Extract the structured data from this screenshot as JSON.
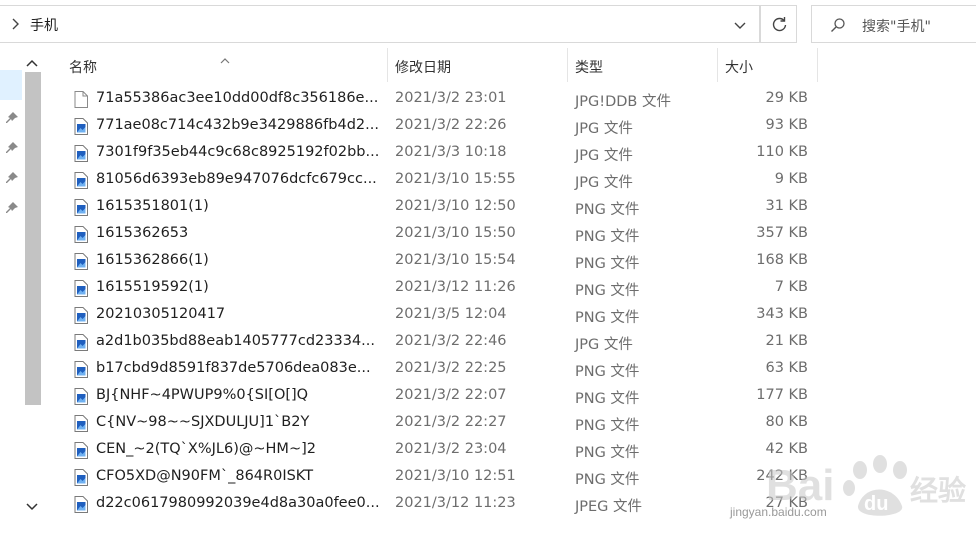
{
  "address": {
    "path": "手机"
  },
  "search": {
    "placeholder": "搜索\"手机\""
  },
  "columns": {
    "name": "名称",
    "date": "修改日期",
    "type": "类型",
    "size": "大小"
  },
  "files": [
    {
      "name": "71a55386ac3ee10dd00df8c356186e...",
      "date": "2021/3/2 23:01",
      "type": "JPG!DDB 文件",
      "size": "29 KB",
      "icon": "blank-file-icon"
    },
    {
      "name": "771ae08c714c432b9e3429886fb4d2...",
      "date": "2021/3/2 22:26",
      "type": "JPG 文件",
      "size": "93 KB",
      "icon": "image-file-icon"
    },
    {
      "name": "7301f9f35eb44c9c68c8925192f02bb...",
      "date": "2021/3/3 10:18",
      "type": "JPG 文件",
      "size": "110 KB",
      "icon": "image-file-icon"
    },
    {
      "name": "81056d6393eb89e947076dcfc679cc...",
      "date": "2021/3/10 15:55",
      "type": "JPG 文件",
      "size": "9 KB",
      "icon": "image-file-icon"
    },
    {
      "name": "1615351801(1)",
      "date": "2021/3/10 12:50",
      "type": "PNG 文件",
      "size": "31 KB",
      "icon": "image-file-icon"
    },
    {
      "name": "1615362653",
      "date": "2021/3/10 15:50",
      "type": "PNG 文件",
      "size": "357 KB",
      "icon": "image-file-icon"
    },
    {
      "name": "1615362866(1)",
      "date": "2021/3/10 15:54",
      "type": "PNG 文件",
      "size": "168 KB",
      "icon": "image-file-icon"
    },
    {
      "name": "1615519592(1)",
      "date": "2021/3/12 11:26",
      "type": "PNG 文件",
      "size": "7 KB",
      "icon": "image-file-icon"
    },
    {
      "name": "20210305120417",
      "date": "2021/3/5 12:04",
      "type": "PNG 文件",
      "size": "343 KB",
      "icon": "image-file-icon"
    },
    {
      "name": "a2d1b035bd88eab1405777cd23334...",
      "date": "2021/3/2 22:46",
      "type": "JPG 文件",
      "size": "21 KB",
      "icon": "image-file-icon"
    },
    {
      "name": "b17cbd9d8591f837de5706dea083e...",
      "date": "2021/3/2 22:25",
      "type": "PNG 文件",
      "size": "63 KB",
      "icon": "image-file-icon"
    },
    {
      "name": "BJ{NHF~4PWUP9%0{SI[O[]Q",
      "date": "2021/3/2 22:07",
      "type": "PNG 文件",
      "size": "177 KB",
      "icon": "image-file-icon"
    },
    {
      "name": "C{NV~98~~SJXDULJU]1`B2Y",
      "date": "2021/3/2 22:27",
      "type": "PNG 文件",
      "size": "80 KB",
      "icon": "image-file-icon"
    },
    {
      "name": "CEN_~2(TQ`X%JL6)@~HM~]2",
      "date": "2021/3/2 23:04",
      "type": "PNG 文件",
      "size": "42 KB",
      "icon": "image-file-icon"
    },
    {
      "name": "CFO5XD@N90FM`_864R0ISKT",
      "date": "2021/3/10 12:51",
      "type": "PNG 文件",
      "size": "242 KB",
      "icon": "image-file-icon"
    },
    {
      "name": "d22c0617980992039e4d8a30a0fee0...",
      "date": "2021/3/12 11:23",
      "type": "JPEG 文件",
      "size": "27 KB",
      "icon": "image-file-icon"
    }
  ],
  "watermark": {
    "text": "jingyan.baidu.com"
  },
  "colors": {
    "selection": "#cce8ff",
    "scroll_thumb": "#c3c3c3",
    "icon_blue": "#1f5fbf",
    "muted_text": "#6d6d6d"
  }
}
